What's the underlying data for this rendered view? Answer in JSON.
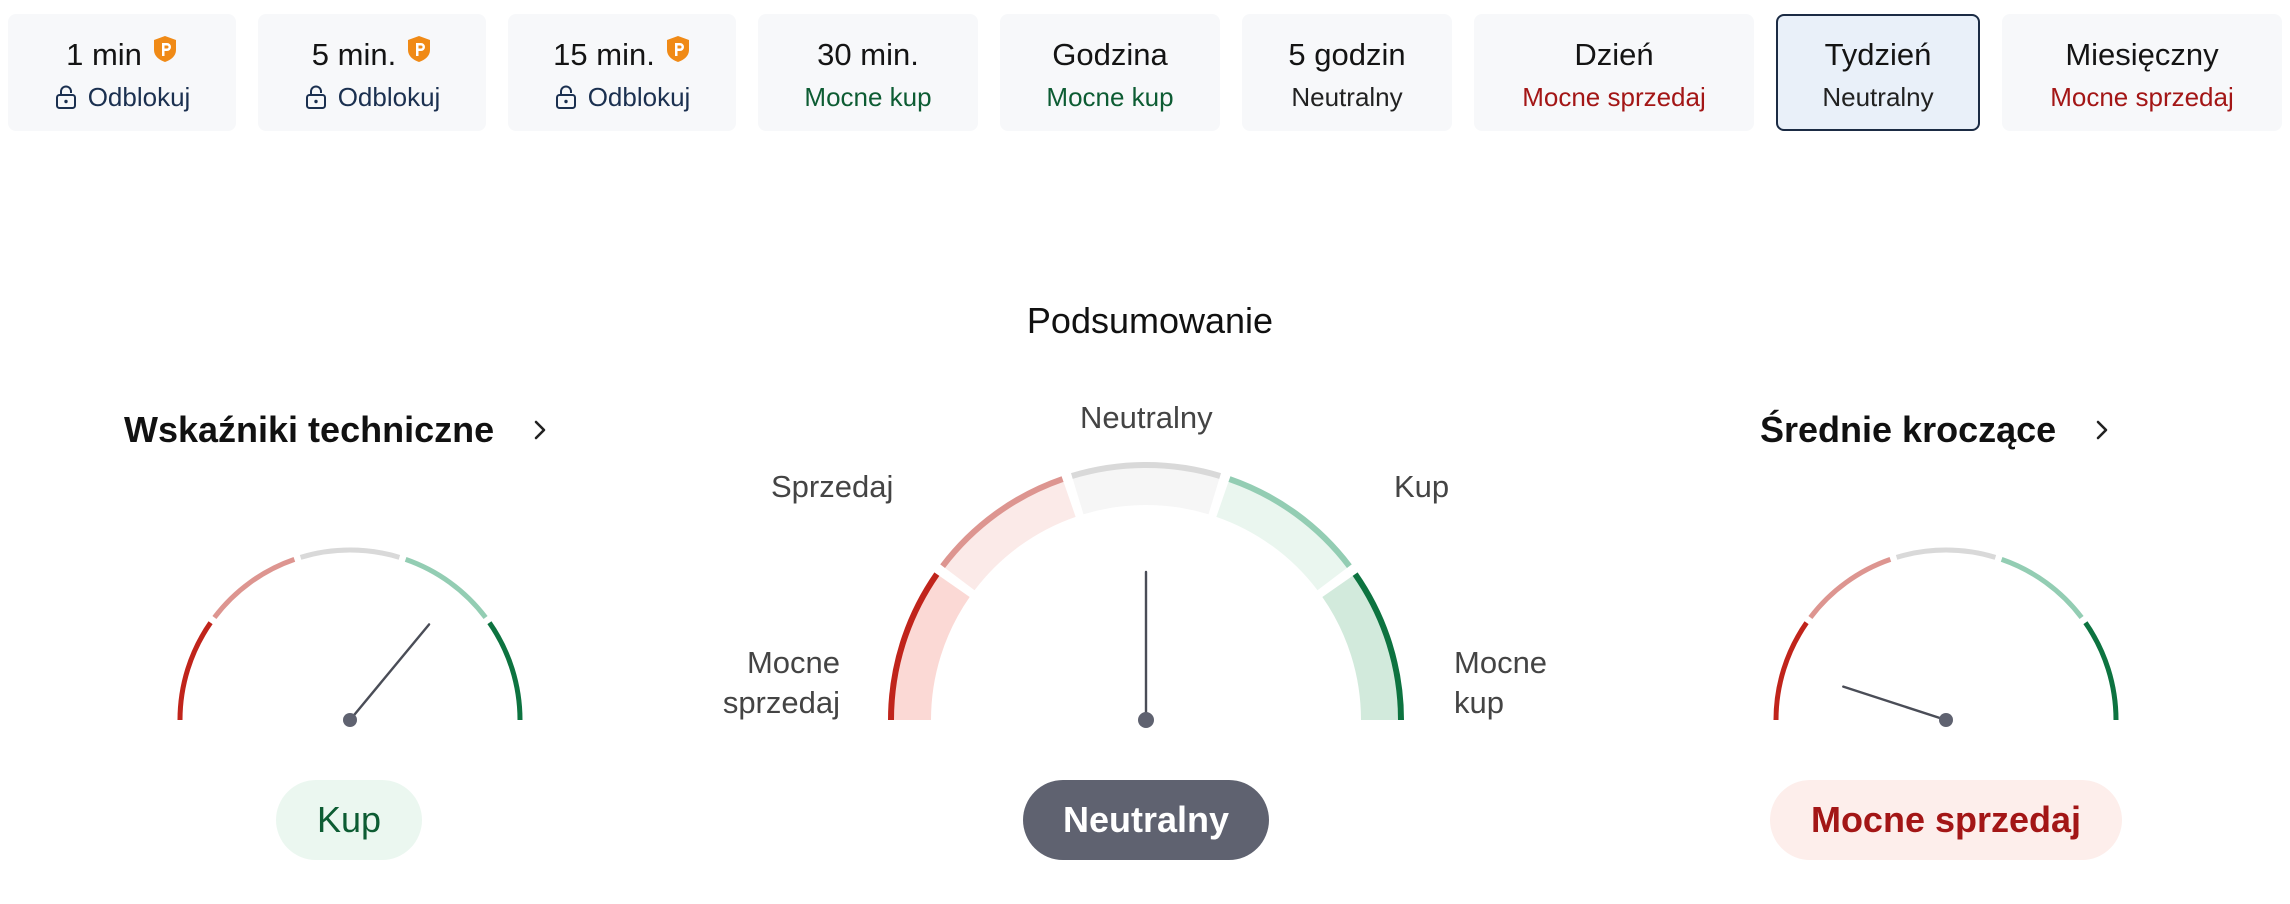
{
  "timeframes": [
    {
      "label": "1 min",
      "status": "Odblokuj",
      "locked": true
    },
    {
      "label": "5 min.",
      "status": "Odblokuj",
      "locked": true
    },
    {
      "label": "15 min.",
      "status": "Odblokuj",
      "locked": true
    },
    {
      "label": "30 min.",
      "status": "Mocne kup",
      "locked": false
    },
    {
      "label": "Godzina",
      "status": "Mocne kup",
      "locked": false
    },
    {
      "label": "5 godzin",
      "status": "Neutralny",
      "locked": false
    },
    {
      "label": "Dzień",
      "status": "Mocne sprzedaj",
      "locked": false
    },
    {
      "label": "Tydzień",
      "status": "Neutralny",
      "locked": false,
      "selected": true
    },
    {
      "label": "Miesięczny",
      "status": "Mocne sprzedaj",
      "locked": false
    }
  ],
  "summary": {
    "title": "Podsumowanie",
    "labels": {
      "neutral": "Neutralny",
      "sell": "Sprzedaj",
      "buy": "Kup",
      "strong_sell_1": "Mocne",
      "strong_sell_2": "sprzedaj",
      "strong_buy_1": "Mocne",
      "strong_buy_2": "kup"
    },
    "verdict": "Neutralny",
    "needle_value": 0.5
  },
  "technical": {
    "title": "Wskaźniki techniczne",
    "verdict": "Kup",
    "needle_value": 0.72
  },
  "moving_averages": {
    "title": "Średnie kroczące",
    "verdict": "Mocne sprzedaj",
    "needle_value": 0.1
  },
  "colors": {
    "strong_sell": "#c0241b",
    "sell": "#dd9590",
    "neutral": "#d9d9d9",
    "buy": "#93cdb3",
    "strong_buy": "#0d7340",
    "accent_text": "#1b3050",
    "pro_orange": "#f08a16"
  },
  "icons": {
    "pro": "pro-badge-icon",
    "lock": "lock-icon",
    "chevron": "chevron-right-icon"
  }
}
